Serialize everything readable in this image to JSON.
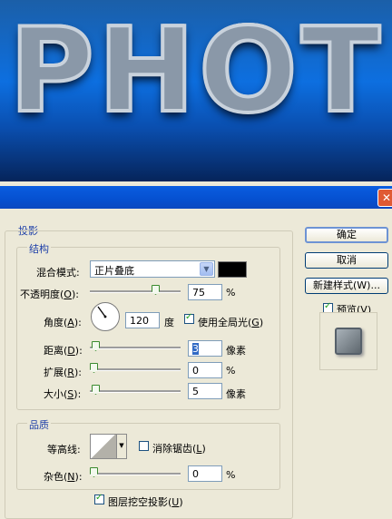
{
  "banner": {
    "text": "PHOT"
  },
  "window": {
    "close": "✕"
  },
  "dialog": {
    "section_title": "投影",
    "structure": {
      "title": "结构",
      "blend_mode": {
        "label_main": "混合模式",
        "label_suffix": ":",
        "value": "正片叠底"
      },
      "opacity": {
        "label_main": "不透明度(",
        "key": "O",
        "label_end": "):",
        "value": "75",
        "unit": "%",
        "slider_fraction": 0.75
      },
      "angle": {
        "label_main": "角度(",
        "key": "A",
        "label_end": "):",
        "value": "120",
        "unit": "度"
      },
      "global_light": {
        "label_main": "使用全局光(",
        "key": "G",
        "label_end": ")",
        "checked": true
      },
      "distance": {
        "label_main": "距离(",
        "key": "D",
        "label_end": "):",
        "value": "3",
        "unit": "像素",
        "slider_fraction": 0.02
      },
      "spread": {
        "label_main": "扩展(",
        "key": "R",
        "label_end": "):",
        "value": "0",
        "unit": "%",
        "slider_fraction": 0.0
      },
      "size": {
        "label_main": "大小(",
        "key": "S",
        "label_end": "):",
        "value": "5",
        "unit": "像素",
        "slider_fraction": 0.02
      }
    },
    "quality": {
      "title": "品质",
      "contour": {
        "label": "等高线:"
      },
      "anti_alias": {
        "label_main": "消除锯齿(",
        "key": "L",
        "label_end": ")",
        "checked": false
      },
      "noise": {
        "label_main": "杂色(",
        "key": "N",
        "label_end": "):",
        "value": "0",
        "unit": "%",
        "slider_fraction": 0.0
      }
    },
    "knockout": {
      "label_main": "图层挖空投影(",
      "key": "U",
      "label_end": ")",
      "checked": true
    },
    "buttons": {
      "ok": "确定",
      "cancel": "取消",
      "new_style": "新建样式(W)..."
    },
    "preview": {
      "label_main": "预览(",
      "key": "V",
      "label_end": ")",
      "checked": true
    }
  },
  "colors": {
    "shadow_color": "#000000",
    "accent": "#1d3fa8",
    "titlebar": "#0a5de0"
  }
}
